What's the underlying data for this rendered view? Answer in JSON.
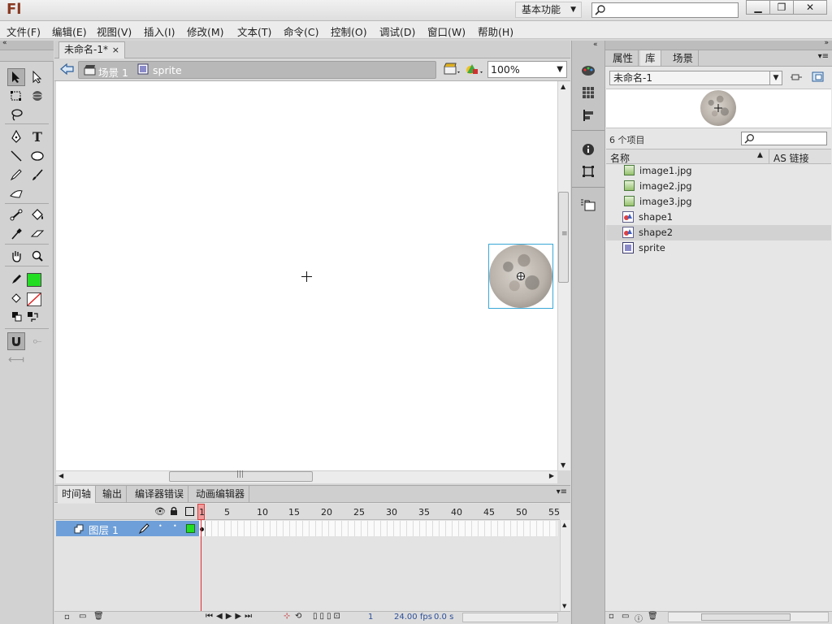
{
  "app": {
    "logo": "Fl",
    "workspace": "基本功能",
    "search_placeholder": ""
  },
  "window_controls": {
    "minimize": "▁",
    "restore": "❐",
    "close": "✕"
  },
  "menu": [
    "文件(F)",
    "编辑(E)",
    "视图(V)",
    "插入(I)",
    "修改(M)",
    "文本(T)",
    "命令(C)",
    "控制(O)",
    "调试(D)",
    "窗口(W)",
    "帮助(H)"
  ],
  "document": {
    "tab_title": "未命名-1*",
    "tab_close": "×",
    "breadcrumb": [
      "场景 1",
      "sprite"
    ],
    "zoom": "100%"
  },
  "colors": {
    "stroke": "#000000",
    "fill": "#22dd22",
    "selection_outline": "#3aa8d8",
    "layer_highlight": "#6e9fd8"
  },
  "timeline": {
    "tabs": [
      "时间轴",
      "输出",
      "编译器错误",
      "动画编辑器"
    ],
    "frame_numbers": [
      "1",
      "5",
      "10",
      "15",
      "20",
      "25",
      "30",
      "35",
      "40",
      "45",
      "50",
      "55"
    ],
    "layer_name": "图层 1",
    "current_frame": "1",
    "fps": "24.00",
    "fps_unit": "fps",
    "time": "0.0",
    "time_unit": "s"
  },
  "right_panel": {
    "tabs": [
      "属性",
      "库",
      "场景"
    ],
    "library_name": "未命名-1",
    "item_count": "6 个项目",
    "col_name": "名称",
    "col_link": "AS 链接",
    "items": [
      {
        "name": "image1.jpg",
        "type": "bitmap"
      },
      {
        "name": "image2.jpg",
        "type": "bitmap"
      },
      {
        "name": "image3.jpg",
        "type": "bitmap"
      },
      {
        "name": "shape1",
        "type": "graphic"
      },
      {
        "name": "shape2",
        "type": "graphic"
      },
      {
        "name": "sprite",
        "type": "movieclip"
      }
    ]
  }
}
